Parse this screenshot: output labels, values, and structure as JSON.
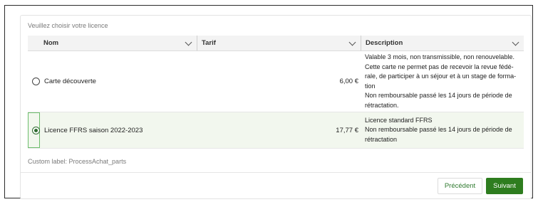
{
  "title": "Veuillez choisir votre licence",
  "columns": {
    "nom": "Nom",
    "tarif": "Tarif",
    "description": "Description"
  },
  "rows": [
    {
      "selected": false,
      "nom": "Carte découverte",
      "tarif": "6,00 €",
      "description": [
        "Valable 3 mois, non transmissible, non renouvelable.",
        "Cette carte ne permet pas de recevoir la revue fédé-",
        "rale, de participer à un séjour et à un stage de forma-",
        "tion",
        "Non remboursable passé les 14 jours de période de",
        "rétractation."
      ]
    },
    {
      "selected": true,
      "nom": "Licence FFRS saison 2022-2023",
      "tarif": "17,77 €",
      "description": [
        "Licence standard FFRS",
        "Non remboursable passé les 14 jours de période de",
        "rétractation"
      ]
    }
  ],
  "custom_label": "Custom label: ProcessAchat_parts",
  "buttons": {
    "previous": "Précédent",
    "next": "Suivant"
  },
  "colors": {
    "accent": "#2e7d1f",
    "selected_row_bg": "#f2f7ee"
  }
}
